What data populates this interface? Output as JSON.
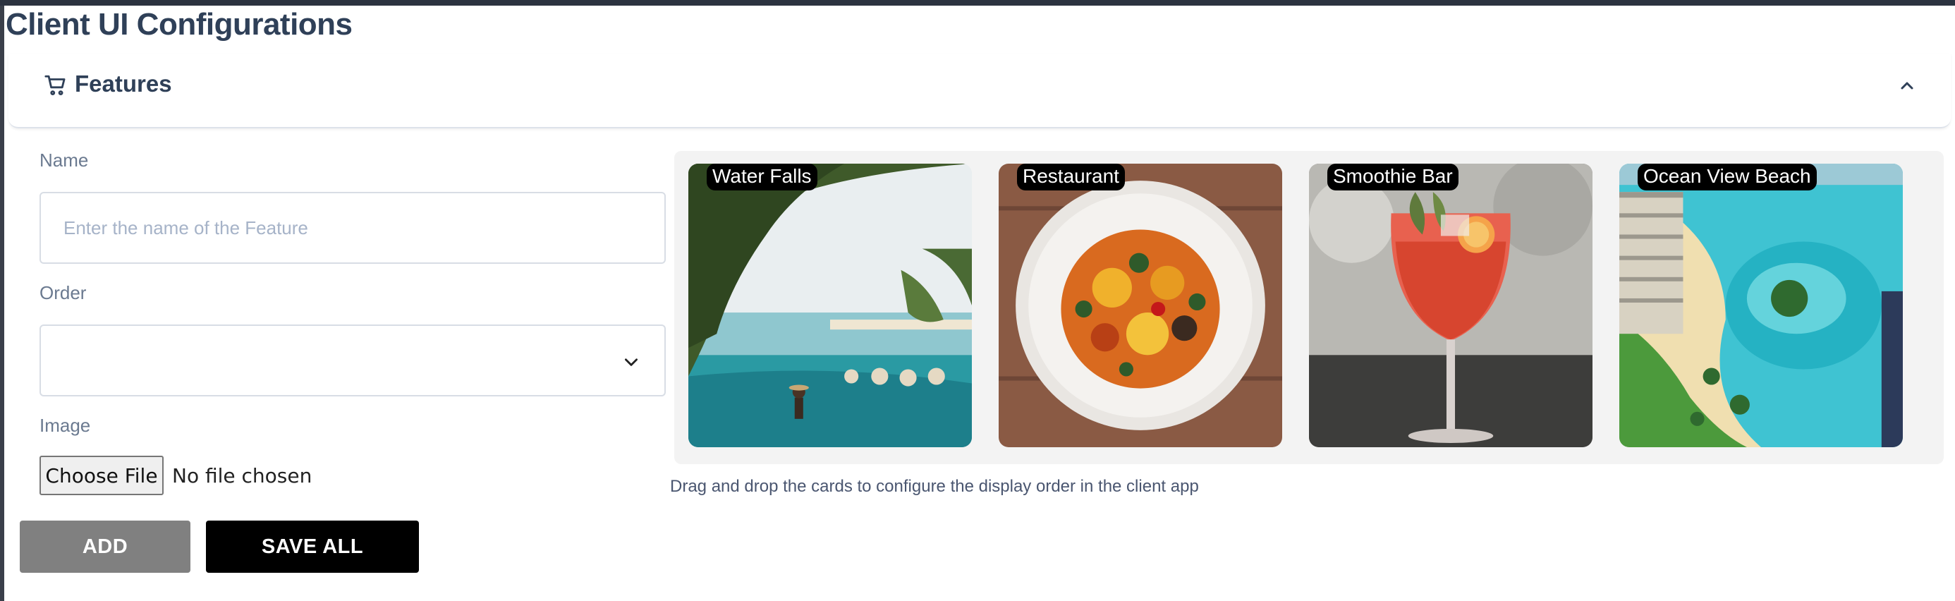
{
  "page": {
    "title": "Client UI Configurations"
  },
  "panel": {
    "title": "Features",
    "icon": "cart-icon",
    "toggle_icon": "chevron-up-icon"
  },
  "form": {
    "name_label": "Name",
    "name_placeholder": "Enter the name of the Feature",
    "name_value": "",
    "order_label": "Order",
    "order_value": "",
    "image_label": "Image",
    "file_button": "Choose File",
    "file_status": "No file chosen"
  },
  "actions": {
    "add_label": "ADD",
    "save_all_label": "SAVE ALL"
  },
  "gallery": {
    "cards": [
      {
        "label": "Water Falls"
      },
      {
        "label": "Restaurant"
      },
      {
        "label": "Smoothie Bar"
      },
      {
        "label": "Ocean View Beach"
      }
    ],
    "hint": "Drag and drop the cards to configure the display order in the client app"
  },
  "colors": {
    "title": "#2f4058",
    "add_button": "#808080",
    "save_button": "#000000",
    "placeholder": "#a6b3c8"
  }
}
